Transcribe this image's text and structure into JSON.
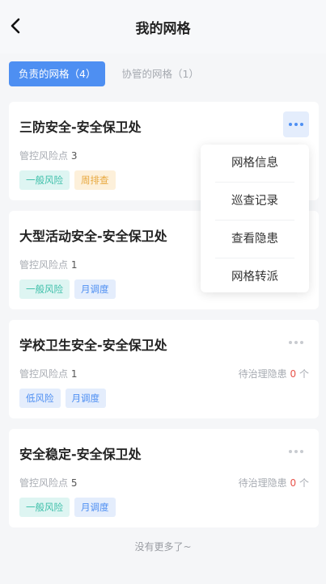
{
  "header": {
    "title": "我的网格"
  },
  "tabs": [
    {
      "label": "负责的网格（4）",
      "active": true
    },
    {
      "label": "协管的网格（1）",
      "active": false
    }
  ],
  "cards": [
    {
      "title": "三防安全-安全保卫处",
      "risk_label": "管控风险点",
      "risk_count": "3",
      "hazard_label": "",
      "hazard_count": "",
      "hazard_unit": "",
      "tags": [
        "一般风险",
        "周排查"
      ]
    },
    {
      "title": "大型活动安全-安全保卫处",
      "risk_label": "管控风险点",
      "risk_count": "1",
      "hazard_label": "",
      "hazard_count": "",
      "hazard_unit": "",
      "tags": [
        "一般风险",
        "月调度"
      ]
    },
    {
      "title": "学校卫生安全-安全保卫处",
      "risk_label": "管控风险点",
      "risk_count": "1",
      "hazard_label": "待治理隐患",
      "hazard_count": "0",
      "hazard_unit": "个",
      "tags": [
        "低风险",
        "月调度"
      ]
    },
    {
      "title": "安全稳定-安全保卫处",
      "risk_label": "管控风险点",
      "risk_count": "5",
      "hazard_label": "待治理隐患",
      "hazard_count": "0",
      "hazard_unit": "个",
      "tags": [
        "一般风险",
        "月调度"
      ]
    }
  ],
  "menu": {
    "items": [
      "网格信息",
      "巡查记录",
      "查看隐患",
      "网格转派"
    ]
  },
  "footer": {
    "text": "没有更多了~"
  },
  "colors": {
    "accent": "#4e8ff2",
    "teal_tag": "#3dbfa9",
    "orange_tag": "#e8a83e",
    "hazard_count": "#e8534a"
  },
  "icons": {
    "back": "chevron-left-icon",
    "more": "more-horizontal-icon"
  }
}
